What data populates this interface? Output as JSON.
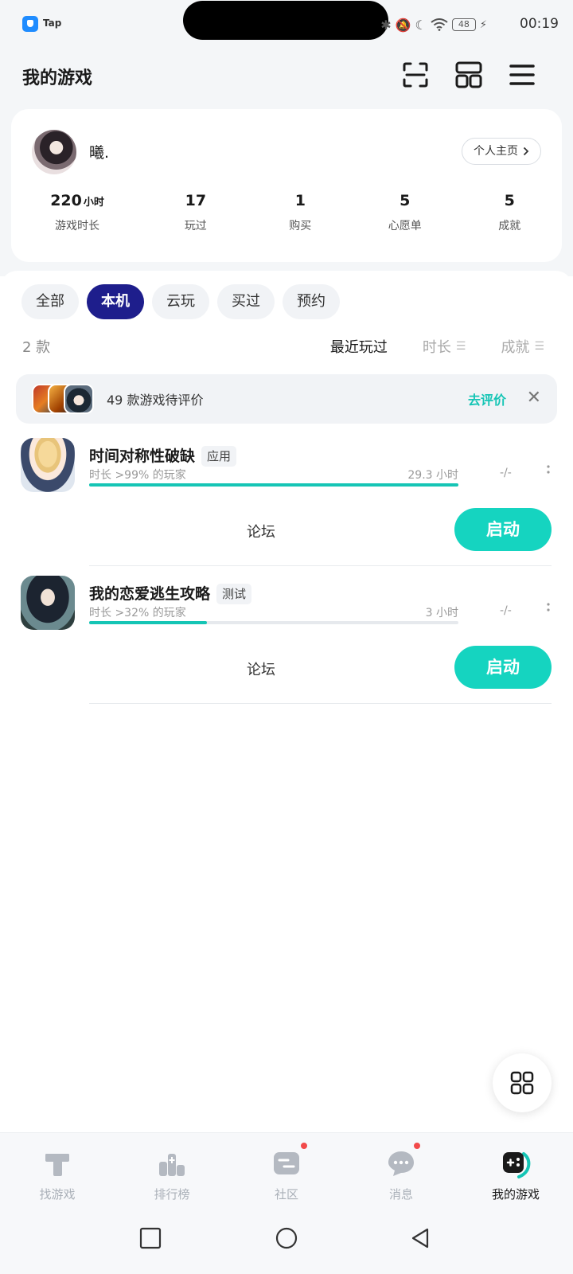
{
  "status_bar": {
    "app_name": "Tap",
    "battery": "48",
    "time": "00:19"
  },
  "header": {
    "title": "我的游戏",
    "icons": [
      "scan-icon",
      "grid-icon",
      "menu-icon"
    ]
  },
  "profile": {
    "username": "曦.",
    "homepage_label": "个人主页",
    "stats": [
      {
        "value": "220",
        "unit": "小时",
        "label": "游戏时长"
      },
      {
        "value": "17",
        "unit": "",
        "label": "玩过"
      },
      {
        "value": "1",
        "unit": "",
        "label": "购买"
      },
      {
        "value": "5",
        "unit": "",
        "label": "心愿单"
      },
      {
        "value": "5",
        "unit": "",
        "label": "成就"
      }
    ]
  },
  "filters": {
    "chips": [
      "全部",
      "本机",
      "云玩",
      "买过",
      "预约"
    ],
    "active": "本机"
  },
  "list_meta": {
    "count": "2 款",
    "sort_options": [
      "最近玩过",
      "时长",
      "成就"
    ],
    "active_sort": "最近玩过"
  },
  "review_banner": {
    "text": "49 款游戏待评价",
    "action": "去评价"
  },
  "games": [
    {
      "name": "时间对称性破缺",
      "tag": "应用",
      "subtitle": "时长 >99% 的玩家",
      "hours": "29.3 小时",
      "progress": 1.0,
      "score": "-/-",
      "forum": "论坛",
      "launch": "启动"
    },
    {
      "name": "我的恋爱逃生攻略",
      "tag": "测试",
      "subtitle": "时长 >32% 的玩家",
      "hours": "3 小时",
      "progress": 0.32,
      "score": "-/-",
      "forum": "论坛",
      "launch": "启动"
    }
  ],
  "bottom_nav": [
    {
      "label": "找游戏",
      "icon": "find-games-icon",
      "badge": false
    },
    {
      "label": "排行榜",
      "icon": "leaderboard-icon",
      "badge": false
    },
    {
      "label": "社区",
      "icon": "community-icon",
      "badge": true
    },
    {
      "label": "消息",
      "icon": "message-icon",
      "badge": true
    },
    {
      "label": "我的游戏",
      "icon": "my-games-icon",
      "badge": false
    }
  ],
  "colors": {
    "accent": "#15c5b5",
    "active_chip": "#1e1e8c",
    "badge": "#f24a4a"
  }
}
